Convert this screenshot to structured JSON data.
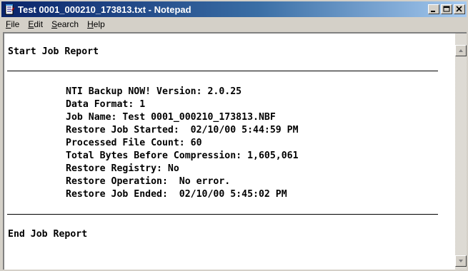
{
  "window": {
    "title": "Test 0001_000210_173813.txt - Notepad"
  },
  "menu": {
    "items": [
      {
        "accel": "F",
        "rest": "ile"
      },
      {
        "accel": "E",
        "rest": "dit"
      },
      {
        "accel": "S",
        "rest": "earch"
      },
      {
        "accel": "H",
        "rest": "elp"
      }
    ]
  },
  "document": {
    "start": "Start Job Report",
    "lines": [
      "NTI Backup NOW! Version: 2.0.25",
      "Data Format: 1",
      "Job Name: Test 0001_000210_173813.NBF",
      "Restore Job Started:  02/10/00 5:44:59 PM",
      "Processed File Count: 60",
      "Total Bytes Before Compression: 1,605,061",
      "Restore Registry: No",
      "Restore Operation:  No error.",
      "Restore Job Ended:  02/10/00 5:45:02 PM"
    ],
    "end": "End Job Report"
  },
  "icons": {
    "title": "notepad-icon",
    "minimize": "minimize-icon",
    "maximize": "maximize-icon",
    "close": "close-icon",
    "scroll_up": "scroll-up-arrow-icon",
    "scroll_down": "scroll-down-arrow-icon"
  },
  "colors": {
    "titlebar_start": "#0a246a",
    "titlebar_end": "#a6caf0",
    "chrome": "#d4d0c8"
  }
}
